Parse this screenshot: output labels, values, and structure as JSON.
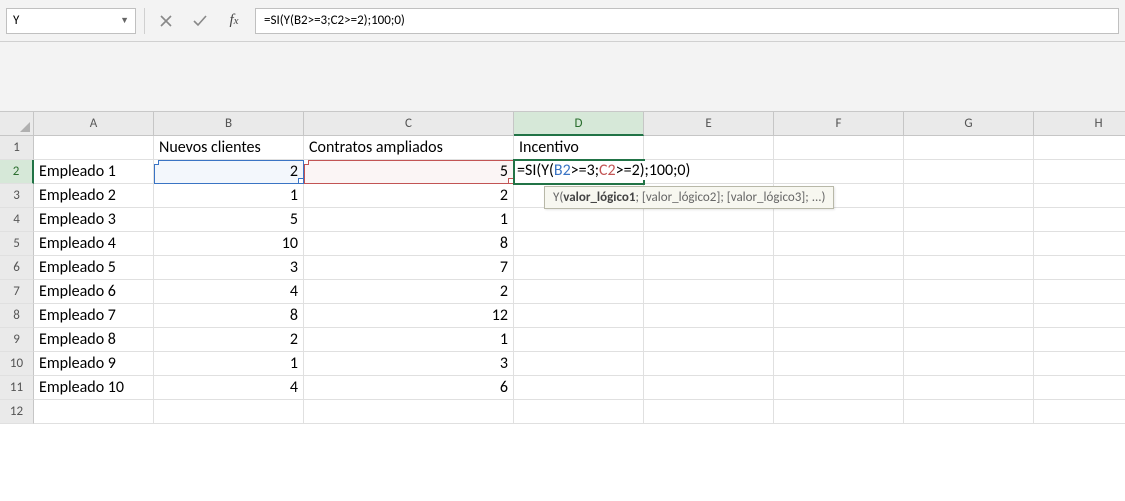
{
  "nameBox": "Y",
  "formulaBar": "=SI(Y(B2>=3;C2>=2);100;0)",
  "columns": [
    "A",
    "B",
    "C",
    "D",
    "E",
    "F",
    "G",
    "H"
  ],
  "colWidths": [
    "wA",
    "wB",
    "wC",
    "wD",
    "wE",
    "wF",
    "wG",
    "wH"
  ],
  "activeCol": "D",
  "activeRow": 2,
  "rows": [
    {
      "r": 1,
      "A": "",
      "B": "Nuevos clientes",
      "C": "Contratos ampliados",
      "D": "Incentivo"
    },
    {
      "r": 2,
      "A": "Empleado 1",
      "B": "2",
      "C": "5",
      "D": ""
    },
    {
      "r": 3,
      "A": "Empleado 2",
      "B": "1",
      "C": "2",
      "D": ""
    },
    {
      "r": 4,
      "A": "Empleado 3",
      "B": "5",
      "C": "1",
      "D": ""
    },
    {
      "r": 5,
      "A": "Empleado 4",
      "B": "10",
      "C": "8",
      "D": ""
    },
    {
      "r": 6,
      "A": "Empleado 5",
      "B": "3",
      "C": "7",
      "D": ""
    },
    {
      "r": 7,
      "A": "Empleado 6",
      "B": "4",
      "C": "2",
      "D": ""
    },
    {
      "r": 8,
      "A": "Empleado 7",
      "B": "8",
      "C": "12",
      "D": ""
    },
    {
      "r": 9,
      "A": "Empleado 8",
      "B": "2",
      "C": "1",
      "D": ""
    },
    {
      "r": 10,
      "A": "Empleado 9",
      "B": "1",
      "C": "3",
      "D": ""
    },
    {
      "r": 11,
      "A": "Empleado 10",
      "B": "4",
      "C": "6",
      "D": ""
    },
    {
      "r": 12,
      "A": "",
      "B": "",
      "C": "",
      "D": ""
    }
  ],
  "editCell": {
    "row": 2,
    "col": "D",
    "parts": [
      {
        "t": "=SI(Y("
      },
      {
        "t": "B2",
        "cls": "c-b"
      },
      {
        "t": ">=3;"
      },
      {
        "t": "C2",
        "cls": "c-r"
      },
      {
        "t": ">=2);100;0)"
      }
    ]
  },
  "refCells": [
    {
      "row": 2,
      "col": "B",
      "cls": "ref-b"
    },
    {
      "row": 2,
      "col": "C",
      "cls": "ref-c"
    }
  ],
  "tooltip": {
    "fn": "Y",
    "bold": "valor_lógico1",
    "rest": "; [valor_lógico2]; [valor_lógico3]; ...)"
  }
}
